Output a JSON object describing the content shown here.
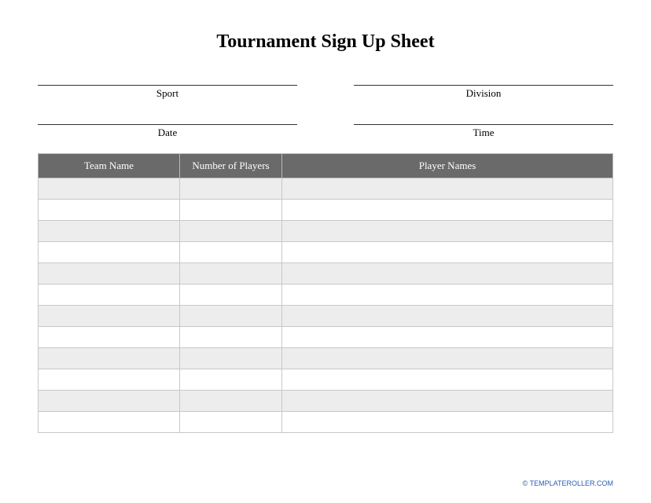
{
  "title": "Tournament Sign Up Sheet",
  "info": {
    "row1": {
      "left": "Sport",
      "right": "Division"
    },
    "row2": {
      "left": "Date",
      "right": "Time"
    }
  },
  "table": {
    "headers": {
      "team": "Team Name",
      "num": "Number of Players",
      "players": "Player Names"
    },
    "rows": [
      {
        "team": "",
        "num": "",
        "players": ""
      },
      {
        "team": "",
        "num": "",
        "players": ""
      },
      {
        "team": "",
        "num": "",
        "players": ""
      },
      {
        "team": "",
        "num": "",
        "players": ""
      },
      {
        "team": "",
        "num": "",
        "players": ""
      },
      {
        "team": "",
        "num": "",
        "players": ""
      },
      {
        "team": "",
        "num": "",
        "players": ""
      },
      {
        "team": "",
        "num": "",
        "players": ""
      },
      {
        "team": "",
        "num": "",
        "players": ""
      },
      {
        "team": "",
        "num": "",
        "players": ""
      },
      {
        "team": "",
        "num": "",
        "players": ""
      },
      {
        "team": "",
        "num": "",
        "players": ""
      }
    ]
  },
  "footer": "© TEMPLATEROLLER.COM"
}
